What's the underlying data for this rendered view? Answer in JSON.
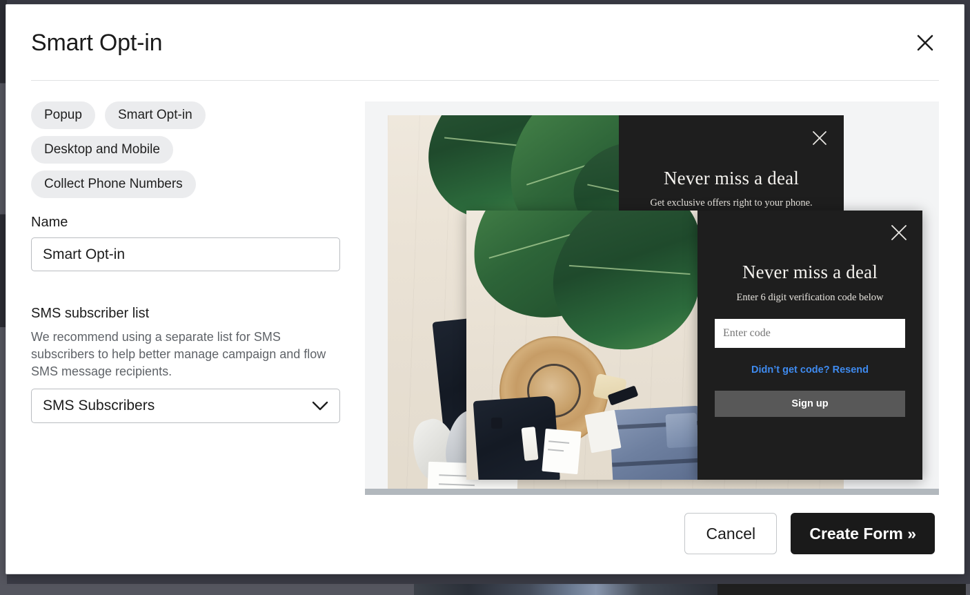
{
  "modal": {
    "title": "Smart Opt-in",
    "close_icon": "close-icon"
  },
  "tags": [
    {
      "label": "Popup"
    },
    {
      "label": "Smart Opt-in"
    },
    {
      "label": "Desktop and Mobile"
    },
    {
      "label": "Collect Phone Numbers"
    }
  ],
  "name_field": {
    "label": "Name",
    "value": "Smart Opt-in",
    "placeholder": "Name"
  },
  "sms_list_field": {
    "label": "SMS subscriber list",
    "description": "We recommend using a separate list for SMS subscribers to help better manage campaign and flow SMS message recipients.",
    "selected": "SMS Subscribers",
    "chevron_icon": "chevron-down-icon"
  },
  "preview": {
    "back_popup": {
      "heading": "Never miss a deal",
      "subheading": "Get exclusive offers right to your phone.",
      "close_icon": "close-icon"
    },
    "front_popup": {
      "heading": "Never miss a deal",
      "subheading": "Enter 6 digit verification code below",
      "code_placeholder": "Enter code",
      "resend_link": "Didn’t get code? Resend",
      "signup_button": "Sign up",
      "close_icon": "close-icon"
    }
  },
  "footer": {
    "cancel_label": "Cancel",
    "create_label": "Create Form »"
  },
  "colors": {
    "accent_link": "#3f8bf0",
    "popup_background": "#1e1e1e",
    "primary_button": "#1a1a1a",
    "tag_background": "#ebecee",
    "preview_background": "#f3f4f5"
  }
}
